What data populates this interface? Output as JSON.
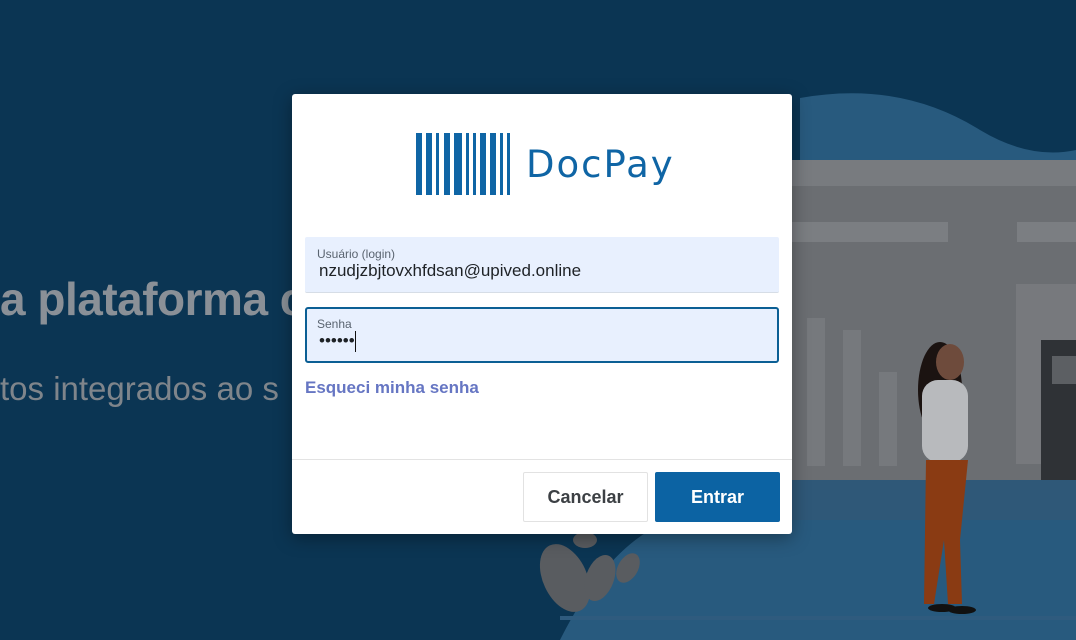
{
  "background": {
    "hero_title": "a plataforma c",
    "hero_subtitle": "tos integrados ao s"
  },
  "modal": {
    "logo_text": "DocPay",
    "username": {
      "label": "Usuário (login)",
      "value": "nzudjzbjtovxhfdsan@upived.online"
    },
    "password": {
      "label": "Senha",
      "masked_value": "••••••"
    },
    "forgot_link": "Esqueci minha senha",
    "cancel_label": "Cancelar",
    "submit_label": "Entrar"
  },
  "colors": {
    "brand": "#0f65a5",
    "primary_button": "#0c63a3",
    "link": "#6676c3",
    "backdrop": "#0b3553",
    "field_bg": "#e8f0fe"
  }
}
